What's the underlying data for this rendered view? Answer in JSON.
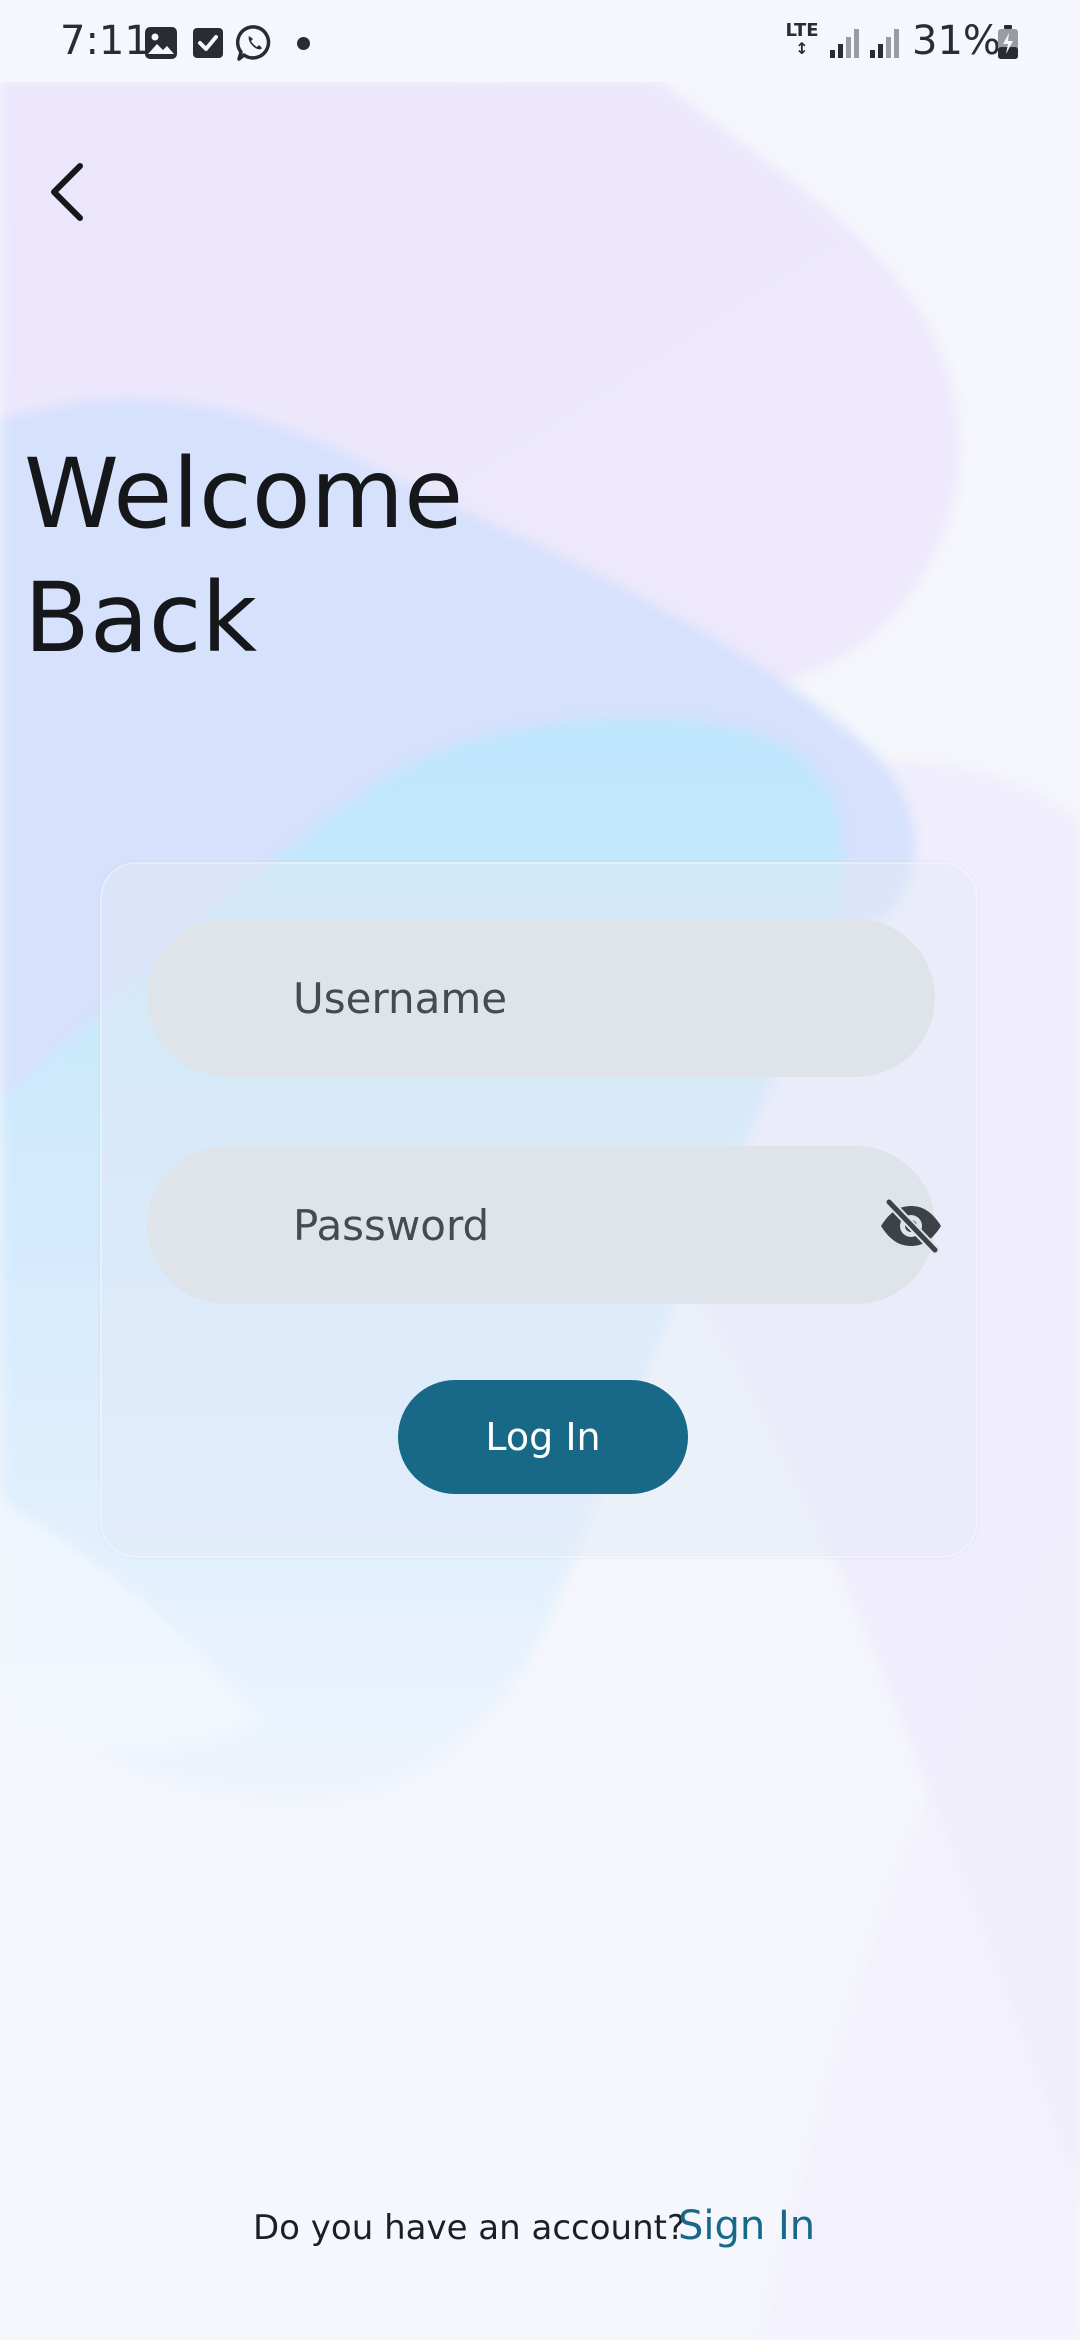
{
  "status_bar": {
    "time": "7:11",
    "network": "LTE",
    "battery_percent": "31%",
    "icons": [
      "gallery-icon",
      "checkbox-icon",
      "whatsapp-icon",
      "notification-dot",
      "lte-icon",
      "signal-icon",
      "signal-icon",
      "battery-charging-icon"
    ]
  },
  "header": {
    "back_icon": "chevron-left-icon",
    "title_line1": "Welcome",
    "title_line2": "Back"
  },
  "form": {
    "username_placeholder": "Username",
    "username_value": "",
    "password_placeholder": "Password",
    "password_value": "",
    "password_toggle_icon": "eye-off-icon",
    "login_label": "Log In"
  },
  "footer": {
    "prompt": "Do you have an account?",
    "link_label": "Sign In"
  },
  "colors": {
    "accent": "#186987",
    "field_background": "#dee4ea",
    "page_background": "#f5f7fc",
    "blob_lavender": "#ebe8fc",
    "blob_periwinkle": "#d5e2fc",
    "blob_sky": "#bfe6fb"
  }
}
